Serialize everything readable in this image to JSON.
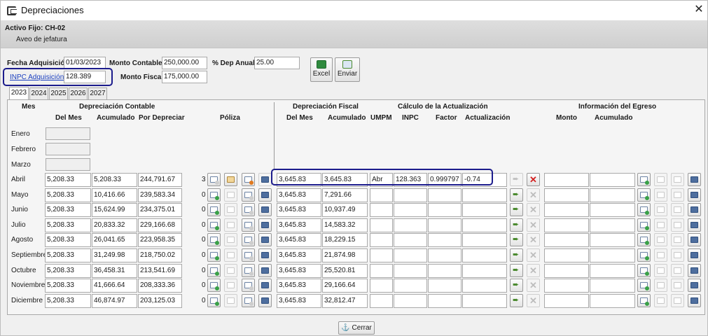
{
  "window": {
    "title": "Depreciaciones"
  },
  "asset": {
    "code": "Activo Fijo: CH-02",
    "description": "Aveo de jefatura"
  },
  "form": {
    "fecha_adquisicion_label": "Fecha Adquisición",
    "fecha_adquisicion_value": "01/03/2023",
    "monto_contable_label": "Monto Contable",
    "monto_contable_value": "250,000.00",
    "dep_anual_label": "% Dep Anual",
    "dep_anual_value": "25.00",
    "inpc_adquisicion_label": "INPC Adquisición",
    "inpc_adquisicion_value": "128.389",
    "monto_fiscal_label": "Monto Fiscal",
    "monto_fiscal_value": "175,000.00"
  },
  "toolbar": {
    "excel_label": "Excel",
    "enviar_label": "Enviar"
  },
  "tabs": [
    "2023",
    "2024",
    "2025",
    "2026",
    "2027"
  ],
  "headers": {
    "mes": "Mes",
    "dep_contable": "Depreciación Contable",
    "del_mes": "Del Mes",
    "acumulado": "Acumulado",
    "por_depreciar": "Por Depreciar",
    "poliza": "Póliza",
    "dep_fiscal": "Depreciación Fiscal",
    "fiscal_del_mes": "Del Mes",
    "fiscal_acumulado": "Acumulado",
    "calculo": "Cálculo de la Actualización",
    "umpm": "UMPM",
    "inpc": "INPC",
    "factor": "Factor",
    "actualizacion": "Actualización",
    "egreso": "Información del Egreso",
    "monto": "Monto",
    "egreso_acumulado": "Acumulado"
  },
  "empty_months": [
    "Enero",
    "Febrero",
    "Marzo"
  ],
  "rows": [
    {
      "month": "Abril",
      "del_mes": "5,208.33",
      "acumulado": "5,208.33",
      "por_depreciar": "244,791.67",
      "poliza_count": "3",
      "fiscal_del_mes": "3,645.83",
      "fiscal_acumulado": "3,645.83",
      "umpm": "Abr",
      "inpc": "128.363",
      "factor": "0.999797",
      "actualizacion": "-0.74",
      "monto": "",
      "egreso_acumulado": ""
    },
    {
      "month": "Mayo",
      "del_mes": "5,208.33",
      "acumulado": "10,416.66",
      "por_depreciar": "239,583.34",
      "poliza_count": "0",
      "fiscal_del_mes": "3,645.83",
      "fiscal_acumulado": "7,291.66",
      "umpm": "",
      "inpc": "",
      "factor": "",
      "actualizacion": "",
      "monto": "",
      "egreso_acumulado": ""
    },
    {
      "month": "Junio",
      "del_mes": "5,208.33",
      "acumulado": "15,624.99",
      "por_depreciar": "234,375.01",
      "poliza_count": "0",
      "fiscal_del_mes": "3,645.83",
      "fiscal_acumulado": "10,937.49",
      "umpm": "",
      "inpc": "",
      "factor": "",
      "actualizacion": "",
      "monto": "",
      "egreso_acumulado": ""
    },
    {
      "month": "Julio",
      "del_mes": "5,208.33",
      "acumulado": "20,833.32",
      "por_depreciar": "229,166.68",
      "poliza_count": "0",
      "fiscal_del_mes": "3,645.83",
      "fiscal_acumulado": "14,583.32",
      "umpm": "",
      "inpc": "",
      "factor": "",
      "actualizacion": "",
      "monto": "",
      "egreso_acumulado": ""
    },
    {
      "month": "Agosto",
      "del_mes": "5,208.33",
      "acumulado": "26,041.65",
      "por_depreciar": "223,958.35",
      "poliza_count": "0",
      "fiscal_del_mes": "3,645.83",
      "fiscal_acumulado": "18,229.15",
      "umpm": "",
      "inpc": "",
      "factor": "",
      "actualizacion": "",
      "monto": "",
      "egreso_acumulado": ""
    },
    {
      "month": "Septiembre",
      "del_mes": "5,208.33",
      "acumulado": "31,249.98",
      "por_depreciar": "218,750.02",
      "poliza_count": "0",
      "fiscal_del_mes": "3,645.83",
      "fiscal_acumulado": "21,874.98",
      "umpm": "",
      "inpc": "",
      "factor": "",
      "actualizacion": "",
      "monto": "",
      "egreso_acumulado": ""
    },
    {
      "month": "Octubre",
      "del_mes": "5,208.33",
      "acumulado": "36,458.31",
      "por_depreciar": "213,541.69",
      "poliza_count": "0",
      "fiscal_del_mes": "3,645.83",
      "fiscal_acumulado": "25,520.81",
      "umpm": "",
      "inpc": "",
      "factor": "",
      "actualizacion": "",
      "monto": "",
      "egreso_acumulado": ""
    },
    {
      "month": "Noviembre",
      "del_mes": "5,208.33",
      "acumulado": "41,666.64",
      "por_depreciar": "208,333.36",
      "poliza_count": "0",
      "fiscal_del_mes": "3,645.83",
      "fiscal_acumulado": "29,166.64",
      "umpm": "",
      "inpc": "",
      "factor": "",
      "actualizacion": "",
      "monto": "",
      "egreso_acumulado": ""
    },
    {
      "month": "Diciembre",
      "del_mes": "5,208.33",
      "acumulado": "46,874.97",
      "por_depreciar": "203,125.03",
      "poliza_count": "0",
      "fiscal_del_mes": "3,645.83",
      "fiscal_acumulado": "32,812.47",
      "umpm": "",
      "inpc": "",
      "factor": "",
      "actualizacion": "",
      "monto": "",
      "egreso_acumulado": ""
    }
  ],
  "footer": {
    "close_label": "Cerrar"
  },
  "icons": {
    "app": "window-icon",
    "close": "close-icon",
    "excel": "excel-icon",
    "enviar": "send-icon",
    "poliza_new": "new-poliza-icon",
    "poliza_note": "edit-poliza-icon",
    "poliza_remove": "remove-poliza-icon",
    "poliza_view": "view-poliza-icon",
    "apply": "apply-arrow-icon",
    "delete": "delete-icon",
    "anchor": "anchor-icon"
  },
  "colors": {
    "highlight": "#1c1c8c",
    "link": "#1a3fbf",
    "delete": "#d32020",
    "apply": "#4b8a2f"
  }
}
